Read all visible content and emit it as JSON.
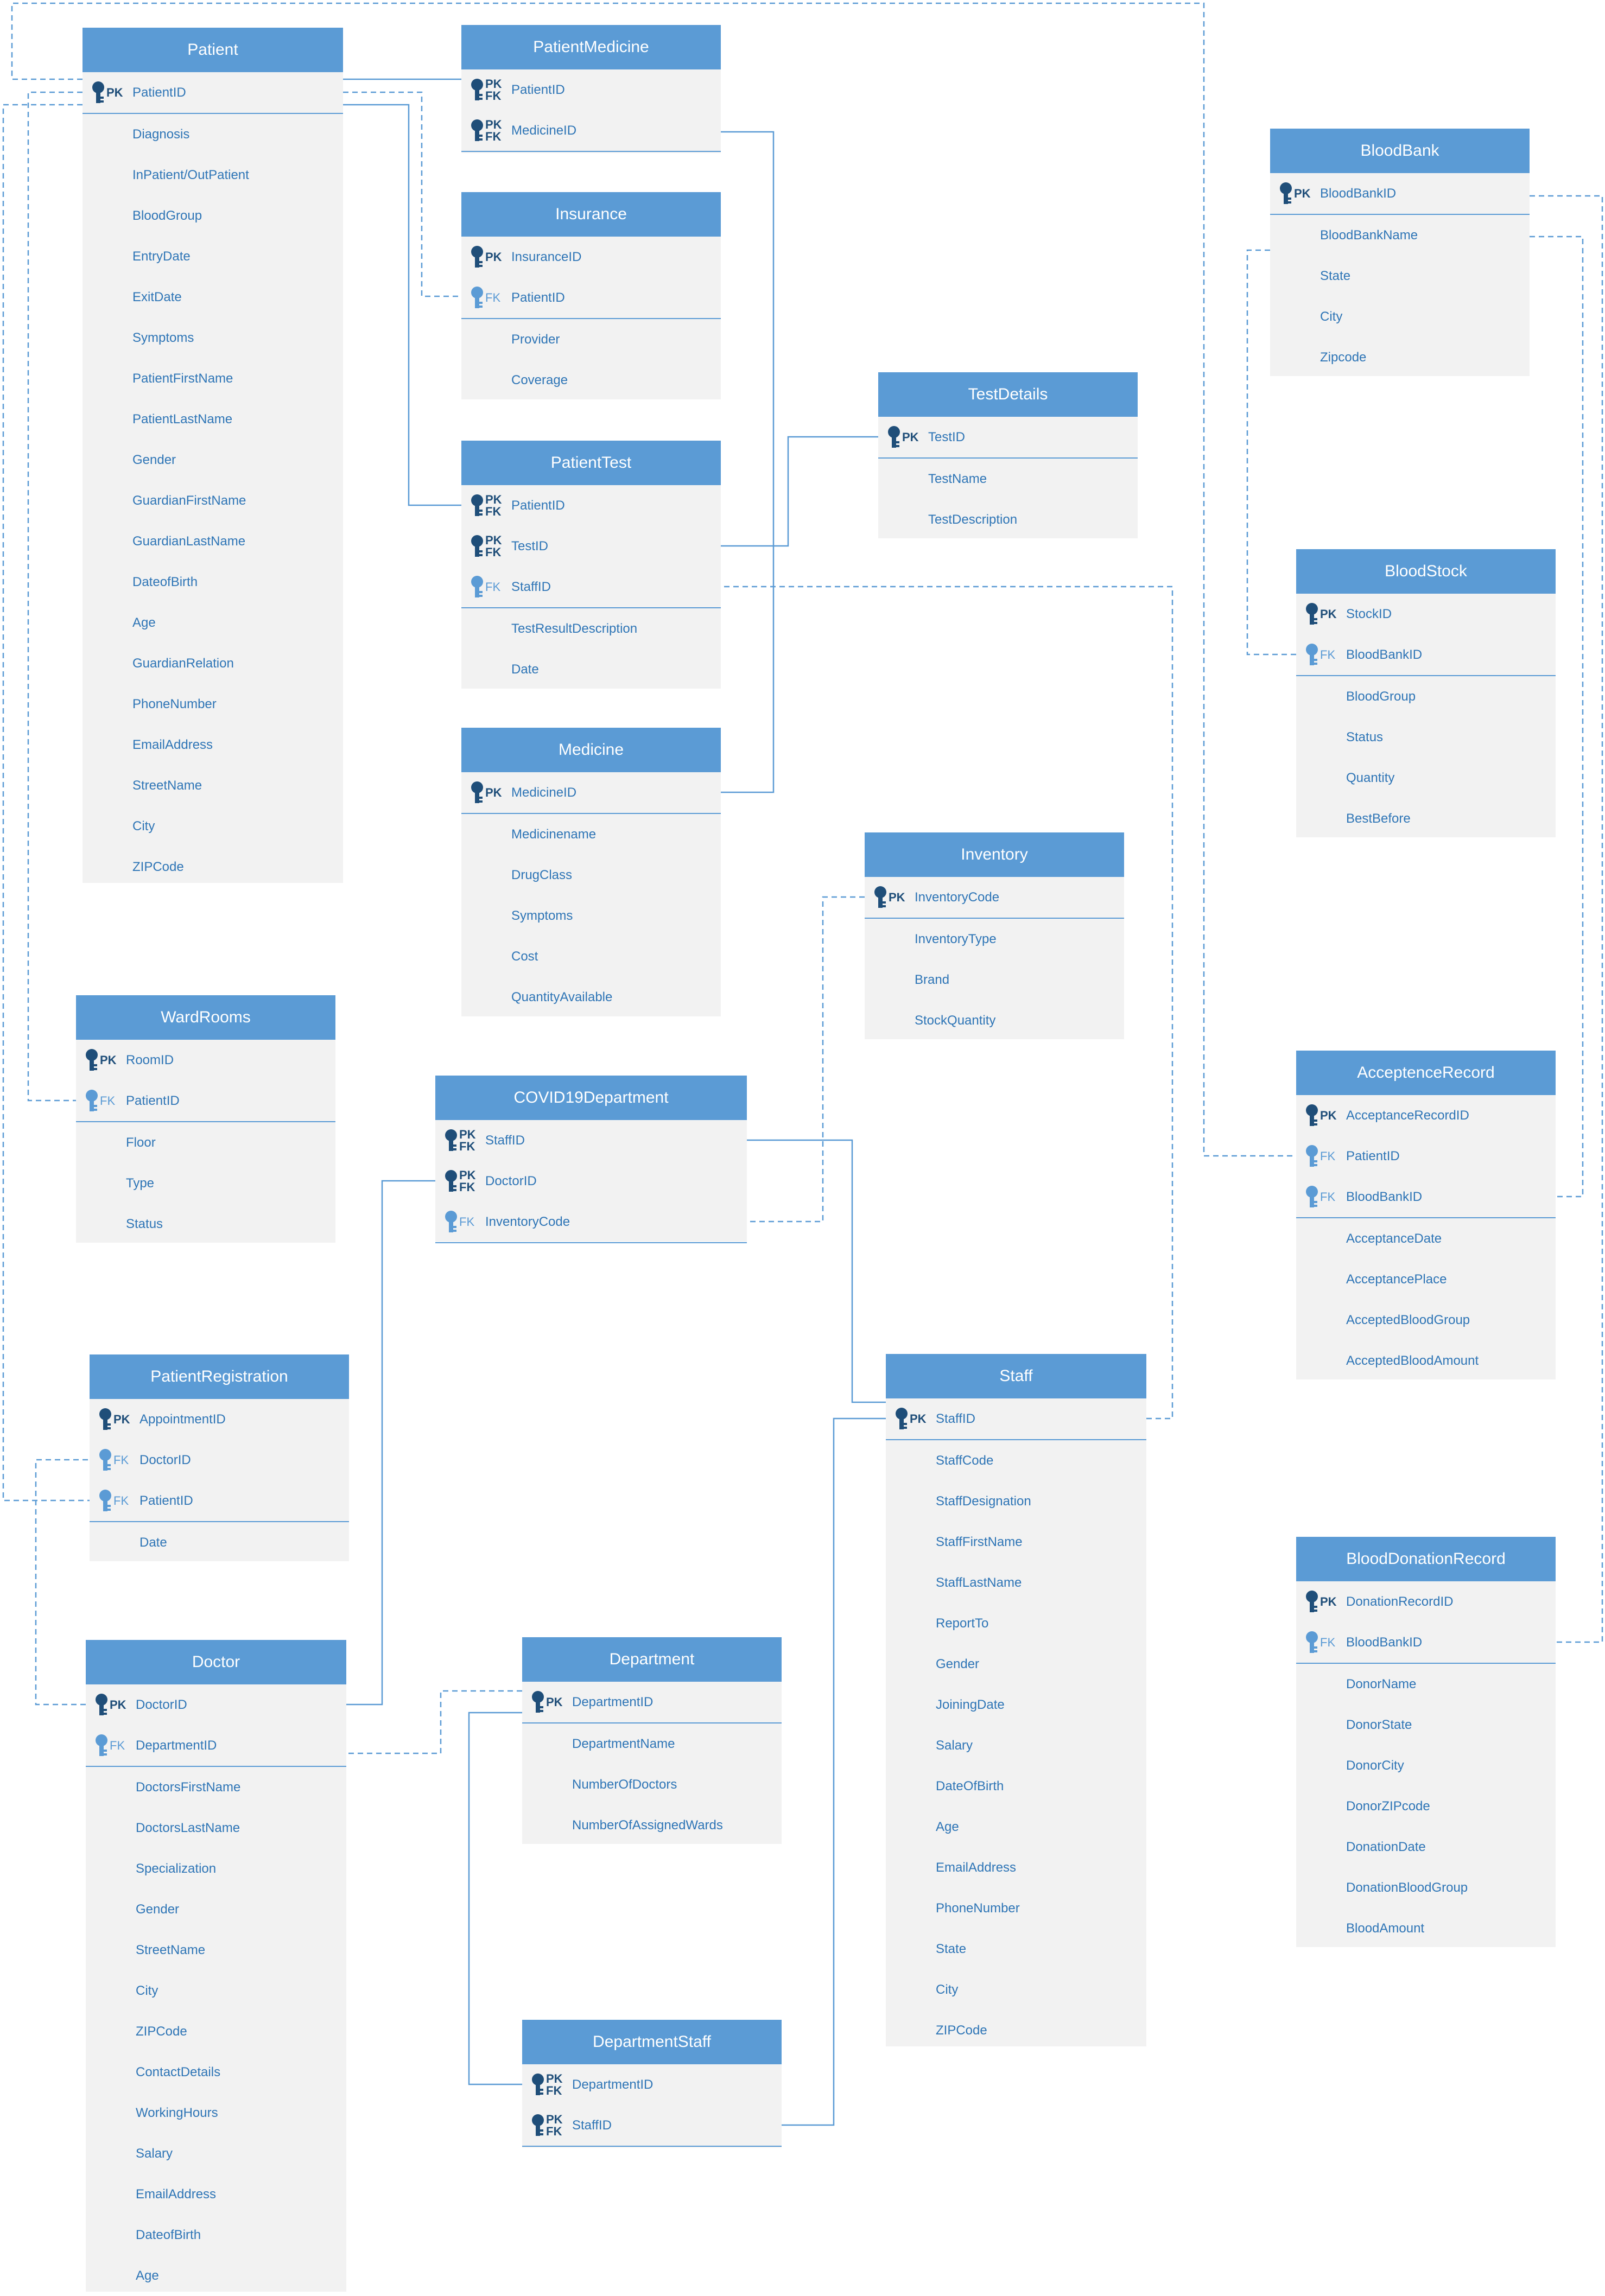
{
  "entities": {
    "patient": {
      "title": "Patient",
      "keys": [
        {
          "tag": "PK",
          "name": "PatientID"
        }
      ],
      "attributes": [
        "Diagnosis",
        "InPatient/OutPatient",
        "BloodGroup",
        "EntryDate",
        "ExitDate",
        "Symptoms",
        "PatientFirstName",
        "PatientLastName",
        "Gender",
        "GuardianFirstName",
        "GuardianLastName",
        "DateofBirth",
        "Age",
        "GuardianRelation",
        "PhoneNumber",
        "EmailAddress",
        "StreetName",
        "City",
        "ZIPCode"
      ]
    },
    "patient_medicine": {
      "title": "PatientMedicine",
      "keys": [
        {
          "tag": "PK|FK",
          "name": "PatientID"
        },
        {
          "tag": "PK|FK",
          "name": "MedicineID"
        }
      ],
      "attributes": []
    },
    "insurance": {
      "title": "Insurance",
      "keys": [
        {
          "tag": "PK",
          "name": "InsuranceID"
        },
        {
          "tag": "FK",
          "name": "PatientID"
        }
      ],
      "attributes": [
        "Provider",
        "Coverage"
      ]
    },
    "patient_test": {
      "title": "PatientTest",
      "keys": [
        {
          "tag": "PK|FK",
          "name": "PatientID"
        },
        {
          "tag": "PK|FK",
          "name": "TestID"
        },
        {
          "tag": "FK",
          "name": "StaffID"
        }
      ],
      "attributes": [
        "TestResultDescription",
        "Date"
      ]
    },
    "medicine": {
      "title": "Medicine",
      "keys": [
        {
          "tag": "PK",
          "name": "MedicineID"
        }
      ],
      "attributes": [
        "Medicinename",
        "DrugClass",
        "Symptoms",
        "Cost",
        "QuantityAvailable"
      ]
    },
    "test_details": {
      "title": "TestDetails",
      "keys": [
        {
          "tag": "PK",
          "name": "TestID"
        }
      ],
      "attributes": [
        "TestName",
        "TestDescription"
      ]
    },
    "inventory": {
      "title": "Inventory",
      "keys": [
        {
          "tag": "PK",
          "name": "InventoryCode"
        }
      ],
      "attributes": [
        "InventoryType",
        "Brand",
        "StockQuantity"
      ]
    },
    "blood_bank": {
      "title": "BloodBank",
      "keys": [
        {
          "tag": "PK",
          "name": "BloodBankID"
        }
      ],
      "attributes": [
        "BloodBankName",
        "State",
        "City",
        "Zipcode"
      ]
    },
    "blood_stock": {
      "title": "BloodStock",
      "keys": [
        {
          "tag": "PK",
          "name": "StockID"
        },
        {
          "tag": "FK",
          "name": "BloodBankID"
        }
      ],
      "attributes": [
        "BloodGroup",
        "Status",
        "Quantity",
        "BestBefore"
      ]
    },
    "ward_rooms": {
      "title": "WardRooms",
      "keys": [
        {
          "tag": "PK",
          "name": "RoomID"
        },
        {
          "tag": "FK",
          "name": "PatientID"
        }
      ],
      "attributes": [
        "Floor",
        "Type",
        "Status"
      ]
    },
    "covid19_department": {
      "title": "COVID19Department",
      "keys": [
        {
          "tag": "PK|FK",
          "name": "StaffID"
        },
        {
          "tag": "PK|FK",
          "name": "DoctorID"
        },
        {
          "tag": "FK",
          "name": "InventoryCode"
        }
      ],
      "attributes": []
    },
    "acceptence_record": {
      "title": "AcceptenceRecord",
      "keys": [
        {
          "tag": "PK",
          "name": "AcceptanceRecordID"
        },
        {
          "tag": "FK",
          "name": "PatientID"
        },
        {
          "tag": "FK",
          "name": "BloodBankID"
        }
      ],
      "attributes": [
        "AcceptanceDate",
        "AcceptancePlace",
        "AcceptedBloodGroup",
        "AcceptedBloodAmount"
      ]
    },
    "patient_registration": {
      "title": "PatientRegistration",
      "keys": [
        {
          "tag": "PK",
          "name": "AppointmentID"
        },
        {
          "tag": "FK",
          "name": "DoctorID"
        },
        {
          "tag": "FK",
          "name": "PatientID"
        }
      ],
      "attributes": [
        "Date"
      ]
    },
    "staff": {
      "title": "Staff",
      "keys": [
        {
          "tag": "PK",
          "name": "StaffID"
        }
      ],
      "attributes": [
        "StaffCode",
        "StaffDesignation",
        "StaffFirstName",
        "StaffLastName",
        "ReportTo",
        "Gender",
        "JoiningDate",
        "Salary",
        "DateOfBirth",
        "Age",
        "EmailAddress",
        "PhoneNumber",
        "State",
        "City",
        "ZIPCode"
      ]
    },
    "blood_donation_record": {
      "title": "BloodDonationRecord",
      "keys": [
        {
          "tag": "PK",
          "name": "DonationRecordID"
        },
        {
          "tag": "FK",
          "name": "BloodBankID"
        }
      ],
      "attributes": [
        "DonorName",
        "DonorState",
        "DonorCity",
        "DonorZIPcode",
        "DonationDate",
        "DonationBloodGroup",
        "BloodAmount"
      ]
    },
    "doctor": {
      "title": "Doctor",
      "keys": [
        {
          "tag": "PK",
          "name": "DoctorID"
        },
        {
          "tag": "FK",
          "name": "DepartmentID"
        }
      ],
      "attributes": [
        "DoctorsFirstName",
        "DoctorsLastName",
        "Specialization",
        "Gender",
        "StreetName",
        "City",
        "ZIPCode",
        "ContactDetails",
        "WorkingHours",
        "Salary",
        "EmailAddress",
        "DateofBirth",
        "Age"
      ]
    },
    "department": {
      "title": "Department",
      "keys": [
        {
          "tag": "PK",
          "name": "DepartmentID"
        }
      ],
      "attributes": [
        "DepartmentName",
        "NumberOfDoctors",
        "NumberOfAssignedWards"
      ]
    },
    "department_staff": {
      "title": "DepartmentStaff",
      "keys": [
        {
          "tag": "PK|FK",
          "name": "DepartmentID"
        },
        {
          "tag": "PK|FK",
          "name": "StaffID"
        }
      ],
      "attributes": []
    }
  },
  "relationships": [
    {
      "from": "Patient.PatientID",
      "to": "PatientMedicine.PatientID",
      "style": "solid"
    },
    {
      "from": "Patient.PatientID",
      "to": "Insurance.PatientID",
      "style": "dashed"
    },
    {
      "from": "Patient.PatientID",
      "to": "PatientTest.PatientID",
      "style": "solid"
    },
    {
      "from": "Patient.PatientID",
      "to": "WardRooms.PatientID",
      "style": "dashed"
    },
    {
      "from": "Patient.PatientID",
      "to": "PatientRegistration.PatientID",
      "style": "dashed"
    },
    {
      "from": "Patient.PatientID",
      "to": "AcceptenceRecord.PatientID",
      "style": "dashed"
    },
    {
      "from": "Medicine.MedicineID",
      "to": "PatientMedicine.MedicineID",
      "style": "solid"
    },
    {
      "from": "TestDetails.TestID",
      "to": "PatientTest.TestID",
      "style": "solid"
    },
    {
      "from": "Staff.StaffID",
      "to": "PatientTest.StaffID",
      "style": "dashed"
    },
    {
      "from": "Staff.StaffID",
      "to": "COVID19Department.StaffID",
      "style": "solid"
    },
    {
      "from": "Doctor.DoctorID",
      "to": "COVID19Department.DoctorID",
      "style": "solid"
    },
    {
      "from": "Inventory.InventoryCode",
      "to": "COVID19Department.InventoryCode",
      "style": "dashed"
    },
    {
      "from": "BloodBank.BloodBankID",
      "to": "BloodStock.BloodBankID",
      "style": "dashed"
    },
    {
      "from": "BloodBank.BloodBankID",
      "to": "AcceptenceRecord.BloodBankID",
      "style": "dashed"
    },
    {
      "from": "BloodBank.BloodBankID",
      "to": "BloodDonationRecord.BloodBankID",
      "style": "dashed"
    },
    {
      "from": "Doctor.DoctorID",
      "to": "PatientRegistration.DoctorID",
      "style": "dashed"
    },
    {
      "from": "Department.DepartmentID",
      "to": "Doctor.DepartmentID",
      "style": "dashed"
    },
    {
      "from": "Department.DepartmentID",
      "to": "DepartmentStaff.DepartmentID",
      "style": "solid"
    },
    {
      "from": "Staff.StaffID",
      "to": "DepartmentStaff.StaffID",
      "style": "solid"
    }
  ],
  "colors": {
    "header": "#5b9bd5",
    "body": "#f2f2f2",
    "text": "#2e75b6",
    "key_icon": "#1f4e79",
    "line": "#5b9bd5"
  }
}
